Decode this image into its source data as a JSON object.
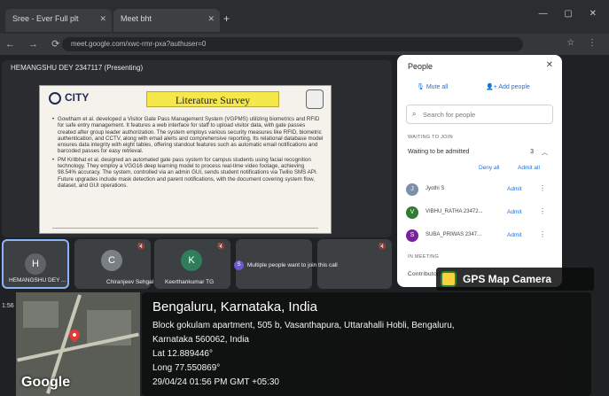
{
  "browser": {
    "tabs": [
      {
        "label": "Sree - Ever Full plt"
      },
      {
        "label": "Meet bht"
      }
    ],
    "url": "meet.google.com/xwc-rmr-pxa?authuser=0"
  },
  "meet": {
    "presenter_label": "HEMANGSHU DEY 2347117 (Presenting)",
    "slide": {
      "logo_text": "CITY",
      "title": "Literature Survey",
      "bullets": [
        "Gowtham et al. developed a Visitor Gate Pass Management System (VGPMS) utilizing biometrics and RFID for safe entry management. It features a web interface for staff to upload visitor data, with gate passes created after group leader authorization. The system employs various security measures like RFID, biometric authentication, and CCTV, along with email alerts and comprehensive reporting. Its relational database model ensures data integrity with eight tables, offering standout features such as automatic email notifications and barcoded passes for easy retrieval.",
        "PM Kritbhat et al. designed an automated gate pass system for campus students using facial recognition technology. They employ a VGG16 deep learning model to process real-time video footage, achieving 98.54% accuracy. The system, controlled via an admin GUI, sends student notifications via Twilio SMS API. Future upgrades include mask detection and parent notifications, with the document covering system flow, dataset, and GUI operations."
      ]
    },
    "tiles": [
      {
        "name": "HEMANGSHU DEY ...",
        "initial": "H",
        "color": "#5f6368"
      },
      {
        "name": "Chiranjeev Sehgal",
        "initial": "C",
        "color": "#7a7f85"
      },
      {
        "name": "Keerthankumar TG",
        "initial": "K",
        "color": "#2e7d5b"
      }
    ],
    "join_text": "Multiple people want to join this call",
    "join_avatar": "S",
    "side_time": "1:56"
  },
  "people_panel": {
    "title": "People",
    "mute_all": "Mute all",
    "add_people": "Add people",
    "search_placeholder": "Search for people",
    "waiting_header": "WAITING TO JOIN",
    "waiting_label": "Waiting to be admitted",
    "waiting_count": "3",
    "deny_all": "Deny all",
    "admit_all": "Admit all",
    "waiting_people": [
      {
        "initial": "J",
        "name": "Jyothi S",
        "admit": "Admit",
        "color": "#7e8fa8"
      },
      {
        "initial": "V",
        "name": "VIBHU_RATHA 23472...",
        "admit": "Admit",
        "color": "#2e7d32"
      },
      {
        "initial": "S",
        "name": "SUBA_PRIWAS 2347...",
        "admit": "Admit",
        "color": "#7b1fa2"
      }
    ],
    "in_meeting_header": "IN MEETING",
    "contributors": "Contributors"
  },
  "gps": {
    "app_name": "GPS Map Camera",
    "city": "Bengaluru, Karnataka, India",
    "address_line1": "Block gokulam apartment, 505 b, Vasanthapura, Uttarahalli Hobli, Bengaluru,",
    "address_line2": "Karnataka 560062, India",
    "lat": "Lat 12.889446°",
    "long": "Long 77.550869°",
    "datetime": "29/04/24 01:56 PM GMT +05:30",
    "map_brand": "Google"
  }
}
